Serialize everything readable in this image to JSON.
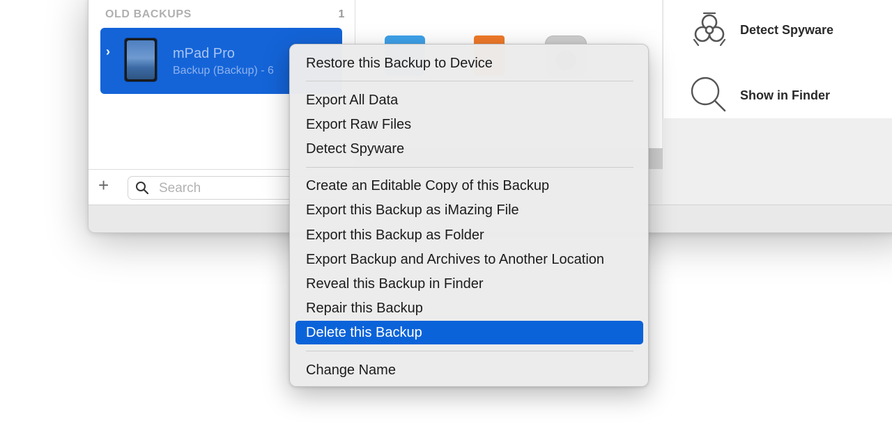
{
  "sidebar": {
    "section_title": "OLD BACKUPS",
    "section_count": "1",
    "backup": {
      "name": "mPad Pro",
      "subtitle": "Backup (Backup) - 6"
    },
    "add_label": "+",
    "search_placeholder": "Search"
  },
  "tools": {
    "detect_spyware": "Detect Spyware",
    "show_in_finder": "Show in Finder"
  },
  "context_menu": {
    "items": [
      {
        "label": "Restore this Backup to Device"
      },
      {
        "label": "Export All Data"
      },
      {
        "label": "Export Raw Files"
      },
      {
        "label": "Detect Spyware"
      },
      {
        "label": "Create an Editable Copy of this Backup"
      },
      {
        "label": "Export this Backup as iMazing File"
      },
      {
        "label": "Export this Backup as Folder"
      },
      {
        "label": "Export Backup and Archives to Another Location"
      },
      {
        "label": "Reveal this Backup in Finder"
      },
      {
        "label": "Repair this Backup"
      },
      {
        "label": "Delete this Backup"
      },
      {
        "label": "Change Name"
      }
    ],
    "selected_label": "Delete this Backup"
  },
  "colors": {
    "accent": "#0b63d9",
    "sidebar_selection": "#1464d8"
  },
  "icons": {
    "tool_spyware": "biohazard-icon",
    "tool_finder": "magnifier-icon",
    "row_disclosure": "chevron-right-icon"
  }
}
